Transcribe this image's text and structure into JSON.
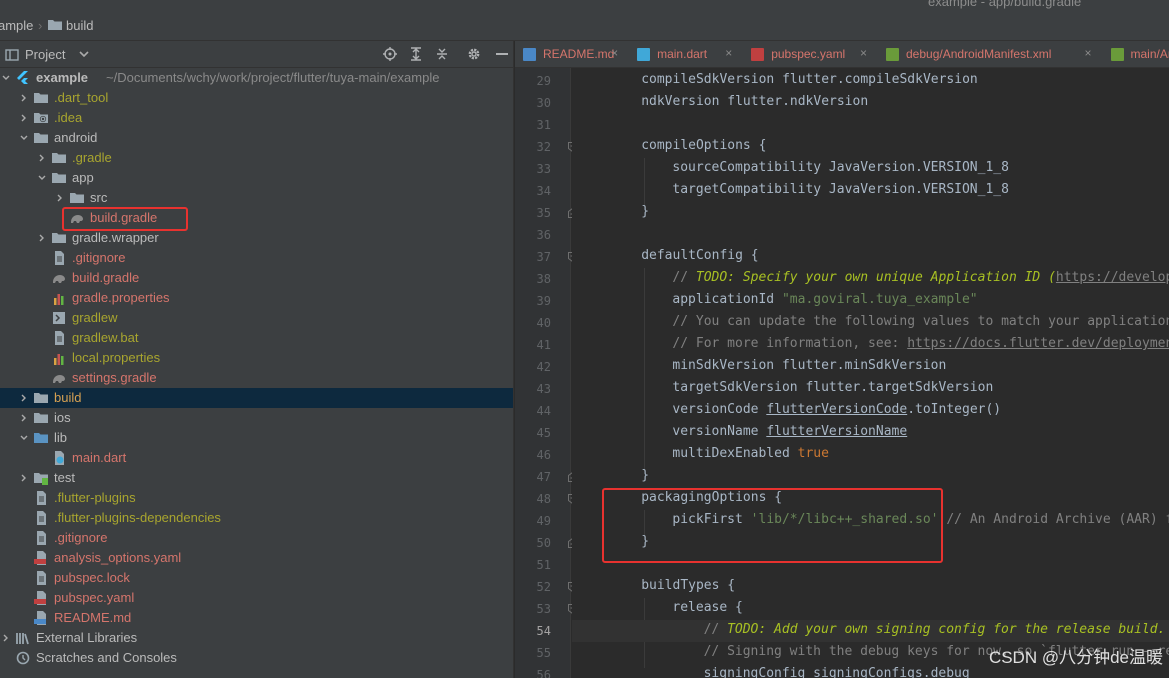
{
  "breadcrumb": {
    "root": "ample",
    "folder": "build"
  },
  "window_title": "example - app/build.gradle",
  "project_panel": {
    "title": "Project",
    "tree": [
      {
        "label": "example",
        "path": "~/Documents/wchy/work/project/flutter/tuya-main/example",
        "indent": 0,
        "arrow": "down",
        "icon": "flutter-module-icon",
        "style": "bold"
      },
      {
        "label": ".dart_tool",
        "indent": 1,
        "arrow": "right",
        "icon": "folder-icon",
        "style": "olive"
      },
      {
        "label": ".idea",
        "indent": 1,
        "arrow": "right",
        "icon": "settings-folder-icon",
        "style": "olive"
      },
      {
        "label": "android",
        "indent": 1,
        "arrow": "down",
        "icon": "folder-icon",
        "style": "norm"
      },
      {
        "label": ".gradle",
        "indent": 2,
        "arrow": "right",
        "icon": "folder-icon",
        "style": "olive"
      },
      {
        "label": "app",
        "indent": 2,
        "arrow": "down",
        "icon": "folder-icon",
        "style": "norm"
      },
      {
        "label": "src",
        "indent": 3,
        "arrow": "right",
        "icon": "folder-icon",
        "style": "norm"
      },
      {
        "label": "build.gradle",
        "indent": 3,
        "arrow": "",
        "icon": "gradle-icon",
        "style": "red"
      },
      {
        "label": "gradle.wrapper",
        "indent": 2,
        "arrow": "right",
        "icon": "folder-icon",
        "style": "norm"
      },
      {
        "label": ".gitignore",
        "indent": 2,
        "arrow": "",
        "icon": "file-icon",
        "style": "red"
      },
      {
        "label": "build.gradle",
        "indent": 2,
        "arrow": "",
        "icon": "gradle-icon",
        "style": "red"
      },
      {
        "label": "gradle.properties",
        "indent": 2,
        "arrow": "",
        "icon": "properties-icon",
        "style": "red"
      },
      {
        "label": "gradlew",
        "indent": 2,
        "arrow": "",
        "icon": "shell-icon",
        "style": "olive"
      },
      {
        "label": "gradlew.bat",
        "indent": 2,
        "arrow": "",
        "icon": "file-icon",
        "style": "olive"
      },
      {
        "label": "local.properties",
        "indent": 2,
        "arrow": "",
        "icon": "properties-icon",
        "style": "olive"
      },
      {
        "label": "settings.gradle",
        "indent": 2,
        "arrow": "",
        "icon": "gradle-icon",
        "style": "red"
      },
      {
        "label": "build",
        "indent": 1,
        "arrow": "right",
        "icon": "folder-icon",
        "style": "sel"
      },
      {
        "label": "ios",
        "indent": 1,
        "arrow": "right",
        "icon": "folder-icon",
        "style": "norm"
      },
      {
        "label": "lib",
        "indent": 1,
        "arrow": "down",
        "icon": "source-folder-icon",
        "style": "norm"
      },
      {
        "label": "main.dart",
        "indent": 2,
        "arrow": "",
        "icon": "dart-file-icon",
        "style": "red"
      },
      {
        "label": "test",
        "indent": 1,
        "arrow": "right",
        "icon": "test-folder-icon",
        "style": "norm"
      },
      {
        "label": ".flutter-plugins",
        "indent": 1,
        "arrow": "",
        "icon": "file-icon",
        "style": "olive"
      },
      {
        "label": ".flutter-plugins-dependencies",
        "indent": 1,
        "arrow": "",
        "icon": "file-icon",
        "style": "olive"
      },
      {
        "label": ".gitignore",
        "indent": 1,
        "arrow": "",
        "icon": "file-icon",
        "style": "red"
      },
      {
        "label": "analysis_options.yaml",
        "indent": 1,
        "arrow": "",
        "icon": "yaml-icon",
        "style": "red"
      },
      {
        "label": "pubspec.lock",
        "indent": 1,
        "arrow": "",
        "icon": "file-icon",
        "style": "red"
      },
      {
        "label": "pubspec.yaml",
        "indent": 1,
        "arrow": "",
        "icon": "yaml-icon",
        "style": "red"
      },
      {
        "label": "README.md",
        "indent": 1,
        "arrow": "",
        "icon": "markdown-icon",
        "style": "red"
      },
      {
        "label": "External Libraries",
        "indent": 0,
        "arrow": "right",
        "icon": "libraries-icon",
        "style": "norm"
      },
      {
        "label": "Scratches and Consoles",
        "indent": 0,
        "arrow": "",
        "icon": "scratches-icon",
        "style": "norm"
      }
    ]
  },
  "tabs": [
    {
      "label": "README.md",
      "icon": "markdown-icon",
      "color": "#4a88c7"
    },
    {
      "label": "main.dart",
      "icon": "dart-file-icon",
      "color": "#40a8d8"
    },
    {
      "label": "pubspec.yaml",
      "icon": "yaml-icon",
      "color": "#c04040"
    },
    {
      "label": "debug/AndroidManifest.xml",
      "icon": "manifest-icon",
      "color": "#6a9b3a"
    },
    {
      "label": "main/AndroidManife",
      "icon": "manifest-icon",
      "color": "#6a9b3a"
    }
  ],
  "editor": {
    "current_line": 54,
    "lines": [
      {
        "n": 29,
        "indent": 1,
        "fold": "",
        "parts": [
          [
            "compileSdkVersion flutter.compileSdkVersion",
            ""
          ]
        ]
      },
      {
        "n": 30,
        "indent": 1,
        "fold": "",
        "parts": [
          [
            "ndkVersion flutter.ndkVersion",
            ""
          ]
        ]
      },
      {
        "n": 31,
        "indent": 0,
        "fold": "",
        "parts": []
      },
      {
        "n": 32,
        "indent": 1,
        "fold": "open",
        "parts": [
          [
            "compileOptions {",
            ""
          ]
        ]
      },
      {
        "n": 33,
        "indent": 2,
        "fold": "",
        "parts": [
          [
            "sourceCompatibility JavaVersion.VERSION_1_8",
            ""
          ]
        ]
      },
      {
        "n": 34,
        "indent": 2,
        "fold": "",
        "parts": [
          [
            "targetCompatibility JavaVersion.VERSION_1_8",
            ""
          ]
        ]
      },
      {
        "n": 35,
        "indent": 1,
        "fold": "close",
        "parts": [
          [
            "}",
            ""
          ]
        ]
      },
      {
        "n": 36,
        "indent": 0,
        "fold": "",
        "parts": []
      },
      {
        "n": 37,
        "indent": 1,
        "fold": "open",
        "parts": [
          [
            "defaultConfig {",
            ""
          ]
        ]
      },
      {
        "n": 38,
        "indent": 2,
        "fold": "",
        "parts": [
          [
            "// ",
            "com"
          ],
          [
            "TODO: Specify your own unique Application ID (",
            "todo"
          ],
          [
            "https://developer.a",
            "link"
          ]
        ]
      },
      {
        "n": 39,
        "indent": 2,
        "fold": "",
        "parts": [
          [
            "applicationId ",
            ""
          ],
          [
            "\"ma.goviral.tuya_example\"",
            "str"
          ]
        ]
      },
      {
        "n": 40,
        "indent": 2,
        "fold": "",
        "parts": [
          [
            "// You can update the following values to match your application nee",
            "com"
          ]
        ]
      },
      {
        "n": 41,
        "indent": 2,
        "fold": "",
        "parts": [
          [
            "// For more information, see: ",
            "com"
          ],
          [
            "https://docs.flutter.dev/deployment/an",
            "link"
          ]
        ]
      },
      {
        "n": 42,
        "indent": 2,
        "fold": "",
        "parts": [
          [
            "minSdkVersion flutter.minSdkVersion",
            ""
          ]
        ]
      },
      {
        "n": 43,
        "indent": 2,
        "fold": "",
        "parts": [
          [
            "targetSdkVersion flutter.targetSdkVersion",
            ""
          ]
        ]
      },
      {
        "n": 44,
        "indent": 2,
        "fold": "",
        "parts": [
          [
            "versionCode ",
            ""
          ],
          [
            "flutterVersionCode",
            "ul"
          ],
          [
            ".toInteger()",
            ""
          ]
        ]
      },
      {
        "n": 45,
        "indent": 2,
        "fold": "",
        "parts": [
          [
            "versionName ",
            ""
          ],
          [
            "flutterVersionName",
            "ul"
          ]
        ]
      },
      {
        "n": 46,
        "indent": 2,
        "fold": "",
        "parts": [
          [
            "multiDexEnabled ",
            ""
          ],
          [
            "true",
            "kw"
          ]
        ]
      },
      {
        "n": 47,
        "indent": 1,
        "fold": "close",
        "parts": [
          [
            "}",
            ""
          ]
        ]
      },
      {
        "n": 48,
        "indent": 1,
        "fold": "open",
        "parts": [
          [
            "packagingOptions {",
            ""
          ]
        ]
      },
      {
        "n": 49,
        "indent": 2,
        "fold": "",
        "parts": [
          [
            "pickFirst ",
            ""
          ],
          [
            "'lib/*/libc++_shared.so'",
            "str"
          ],
          [
            " // An Android Archive (AAR) file",
            "com"
          ]
        ]
      },
      {
        "n": 50,
        "indent": 1,
        "fold": "close",
        "parts": [
          [
            "}",
            ""
          ]
        ]
      },
      {
        "n": 51,
        "indent": 0,
        "fold": "",
        "parts": []
      },
      {
        "n": 52,
        "indent": 1,
        "fold": "open",
        "parts": [
          [
            "buildTypes {",
            ""
          ]
        ]
      },
      {
        "n": 53,
        "indent": 2,
        "fold": "open",
        "parts": [
          [
            "release {",
            ""
          ]
        ]
      },
      {
        "n": 54,
        "indent": 3,
        "fold": "bulb",
        "parts": [
          [
            "// ",
            "com"
          ],
          [
            "TODO: Add your own signing config for the release build.",
            "todo"
          ]
        ]
      },
      {
        "n": 55,
        "indent": 3,
        "fold": "",
        "parts": [
          [
            "// Signing with the debug keys for now, so `flutter run --releas",
            "com"
          ]
        ]
      },
      {
        "n": 56,
        "indent": 3,
        "fold": "",
        "parts": [
          [
            "signingConfig signingConfigs.debug",
            ""
          ]
        ]
      }
    ]
  },
  "watermark": "CSDN @八分钟de温暖"
}
